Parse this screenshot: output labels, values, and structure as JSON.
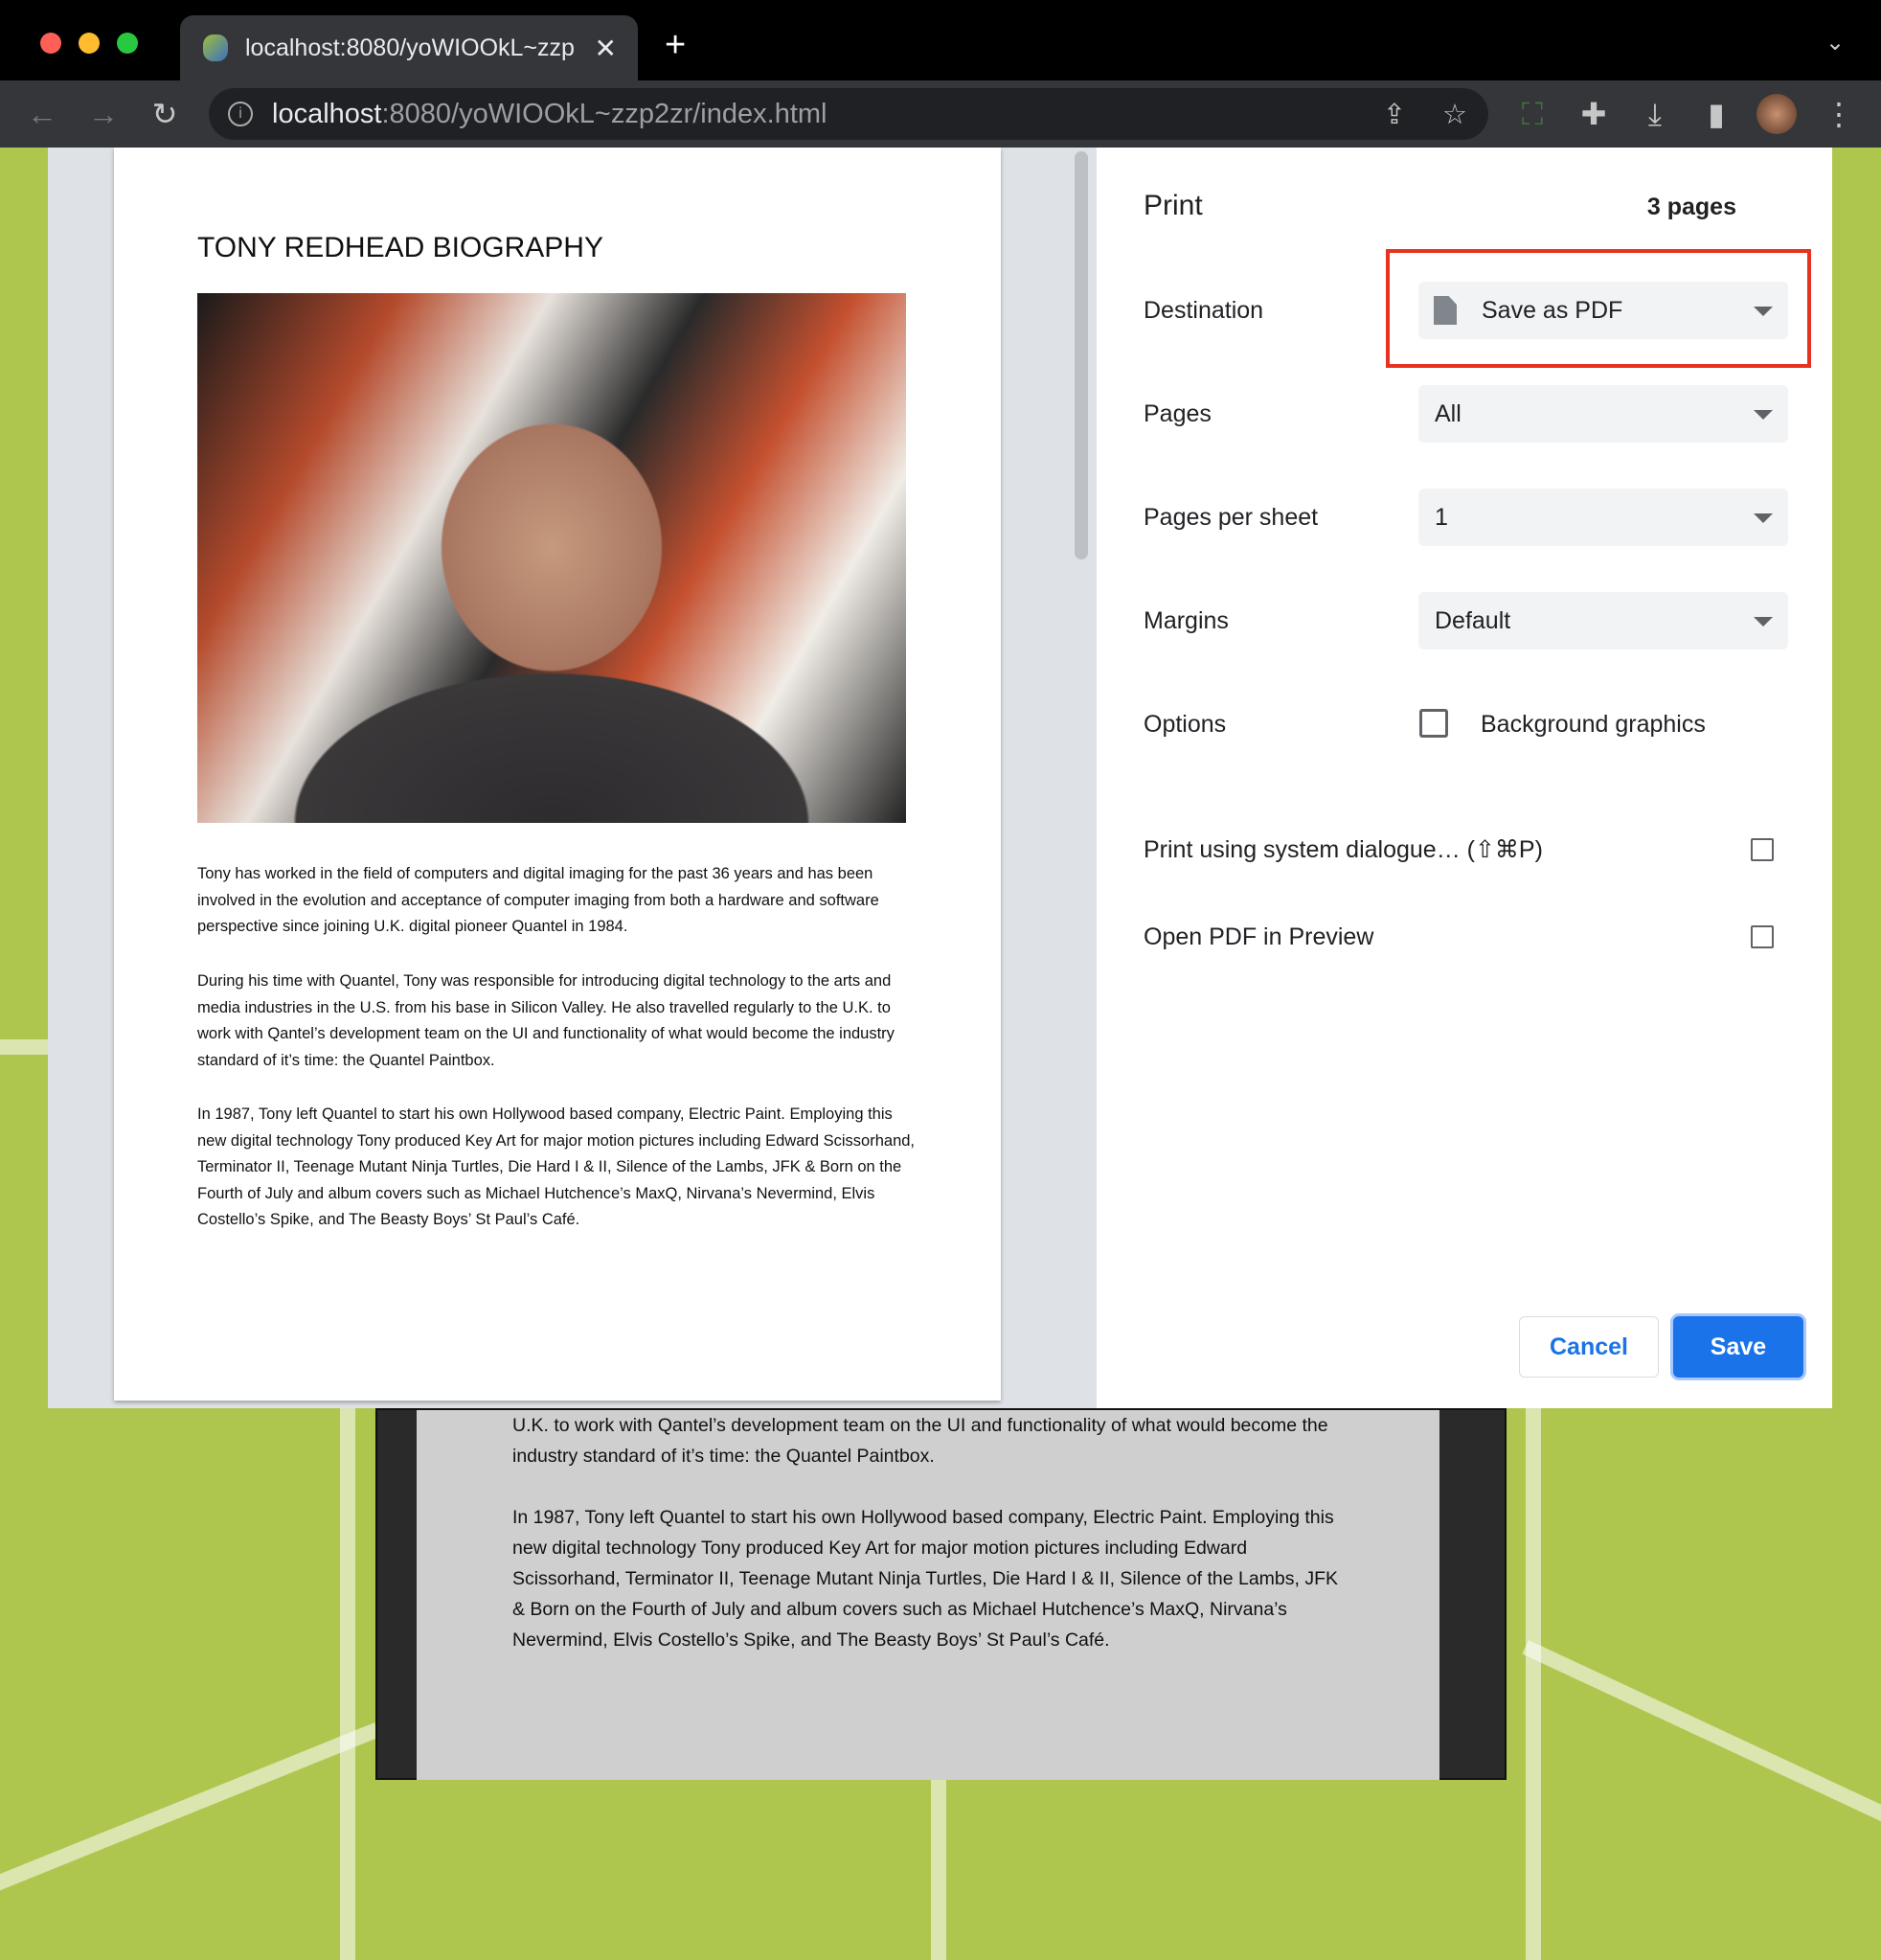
{
  "browser": {
    "tab_title": "localhost:8080/yoWIOOkL~zzp",
    "url_host": "localhost",
    "url_rest": ":8080/yoWIOOkL~zzp2zr/index.html"
  },
  "document": {
    "title": "TONY REDHEAD BIOGRAPHY",
    "paragraphs": [
      "Tony has worked in the field of computers and digital imaging for the past 36 years and has been involved in the evolution and acceptance of computer imaging from both a hardware and software perspective since joining U.K. digital pioneer Quantel in 1984.",
      "During his time with Quantel, Tony was responsible for introducing digital technology to the arts and media industries in the U.S. from his base in Silicon Valley. He also travelled regularly to the U.K. to work with Qantel’s development team on the UI and functionality of what would become the industry standard of it’s time: the Quantel Paintbox.",
      "In 1987, Tony left Quantel to start his own Hollywood based company, Electric Paint.  Employing this new digital technology Tony produced Key Art for major motion pictures including Edward Scissorhand, Terminator II, Teenage Mutant Ninja Turtles, Die Hard I & II, Silence of the Lambs, JFK & Born on the Fourth of July and album covers such as Michael Hutchence’s MaxQ, Nirvana’s Nevermind, Elvis Costello’s Spike, and The Beasty Boys’ St Paul’s Café."
    ]
  },
  "background_page": {
    "paragraphs": [
      "U.K. to work with Qantel’s development team on the UI and functionality of what would become the industry standard of it’s time: the Quantel Paintbox.",
      "In 1987, Tony left Quantel to start his own Hollywood based company, Electric Paint.  Employing this new digital technology Tony produced Key Art for major motion pictures including Edward Scissorhand, Terminator II, Teenage Mutant Ninja Turtles, Die Hard I & II, Silence of the Lambs, JFK & Born on the Fourth of July and album covers such as Michael Hutchence’s MaxQ, Nirvana’s Nevermind, Elvis Costello’s Spike, and The Beasty Boys’ St Paul’s Café."
    ]
  },
  "print": {
    "title": "Print",
    "page_count": "3 pages",
    "destination_label": "Destination",
    "destination_value": "Save as PDF",
    "pages_label": "Pages",
    "pages_value": "All",
    "pps_label": "Pages per sheet",
    "pps_value": "1",
    "margins_label": "Margins",
    "margins_value": "Default",
    "options_label": "Options",
    "background_graphics": "Background graphics",
    "background_graphics_checked": false,
    "system_dialog": "Print using system dialogue… (⇧⌘P)",
    "open_preview": "Open PDF in Preview",
    "cancel": "Cancel",
    "save": "Save"
  },
  "colors": {
    "highlight": "#e8321f",
    "accent": "#1a73e8",
    "background": "#aec64e"
  }
}
